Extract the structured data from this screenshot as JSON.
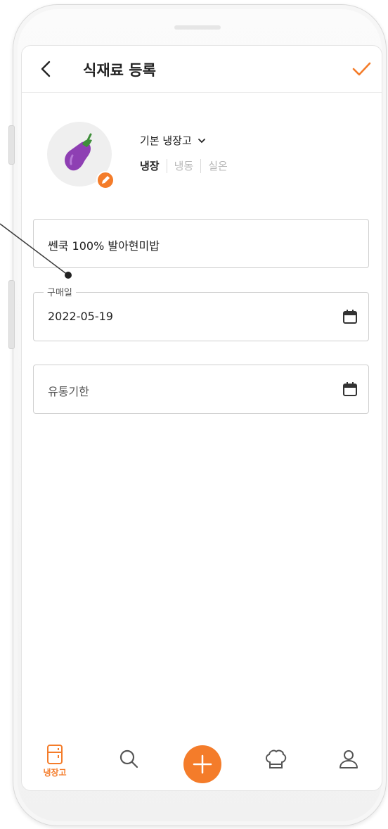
{
  "header": {
    "title": "식재료 등록",
    "back_icon": "chevron-left-icon",
    "confirm_icon": "check-icon"
  },
  "item": {
    "image_icon": "eggplant-icon",
    "edit_icon": "pencil-icon",
    "fridge_select": "기본 냉장고",
    "storage_tabs": [
      "냉장",
      "냉동",
      "실온"
    ],
    "active_storage": "냉장"
  },
  "form": {
    "name_value": "쎈쿡 100% 발아현미밥",
    "purchase_label": "구매일",
    "purchase_value": "2022-05-19",
    "expiry_placeholder": "유통기한"
  },
  "nav": {
    "fridge_label": "냉장고",
    "items": [
      "fridge-icon",
      "search-icon",
      "add-icon",
      "chef-hat-icon",
      "user-icon"
    ]
  },
  "colors": {
    "accent": "#f47c2a",
    "eggplant": "#8e3fb3",
    "stem": "#3f8f3a"
  }
}
